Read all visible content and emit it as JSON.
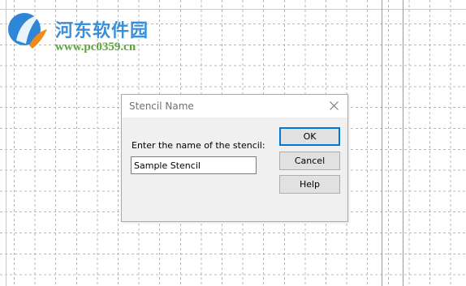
{
  "watermark": {
    "title": "河东软件园",
    "url": "www.pc0359.cn"
  },
  "dialog": {
    "title": "Stencil Name",
    "prompt": "Enter the name of the stencil:",
    "name_value": "Sample Stencil",
    "buttons": {
      "ok": "OK",
      "cancel": "Cancel",
      "help": "Help"
    }
  },
  "colors": {
    "grid_line": "#b8b8b8",
    "page_margin": "#e8d24a",
    "page_edge": "#9a9a9a",
    "default_button_border": "#0078d7"
  },
  "icons": {
    "close": "close-icon",
    "logo": "site-logo"
  }
}
